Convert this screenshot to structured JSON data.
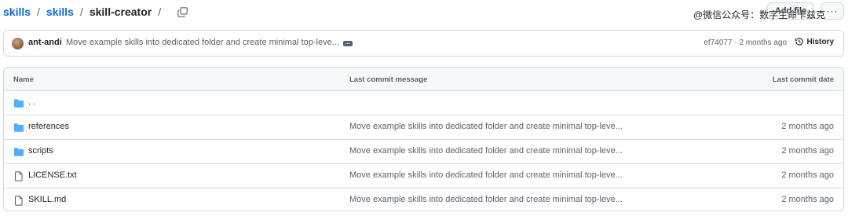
{
  "breadcrumb": {
    "items": [
      "skills",
      "skills"
    ],
    "current": "skill-creator",
    "separator": "/",
    "trailing_separator": "/"
  },
  "toolbar": {
    "add_file_label": "Add file",
    "more_label": "···"
  },
  "watermark": "@微信公众号：数字生命卡兹克",
  "commit": {
    "author": "ant-andi",
    "message": "Move example skills into dedicated folder and create minimal top-leve...",
    "meta": "ef74077 · 2 months ago",
    "history_label": "History"
  },
  "table": {
    "headers": {
      "name": "Name",
      "message": "Last commit message",
      "date": "Last commit date"
    },
    "parent_label": ". .",
    "rows": [
      {
        "name": "references",
        "message": "Move example skills into dedicated folder and create minimal top-leve...",
        "date": "2 months ago",
        "icon": "folder-icon"
      },
      {
        "name": "scripts",
        "message": "Move example skills into dedicated folder and create minimal top-leve...",
        "date": "2 months ago",
        "icon": "folder-icon"
      },
      {
        "name": "LICENSE.txt",
        "message": "Move example skills into dedicated folder and create minimal top-leve...",
        "date": "2 months ago",
        "icon": "file-icon"
      },
      {
        "name": "SKILL.md",
        "message": "Move example skills into dedicated folder and create minimal top-leve...",
        "date": "2 months ago",
        "icon": "file-icon"
      }
    ]
  },
  "colors": {
    "link": "#0969da",
    "folder": "#54aeff",
    "border": "#d1d9e0",
    "muted": "#59636e"
  }
}
